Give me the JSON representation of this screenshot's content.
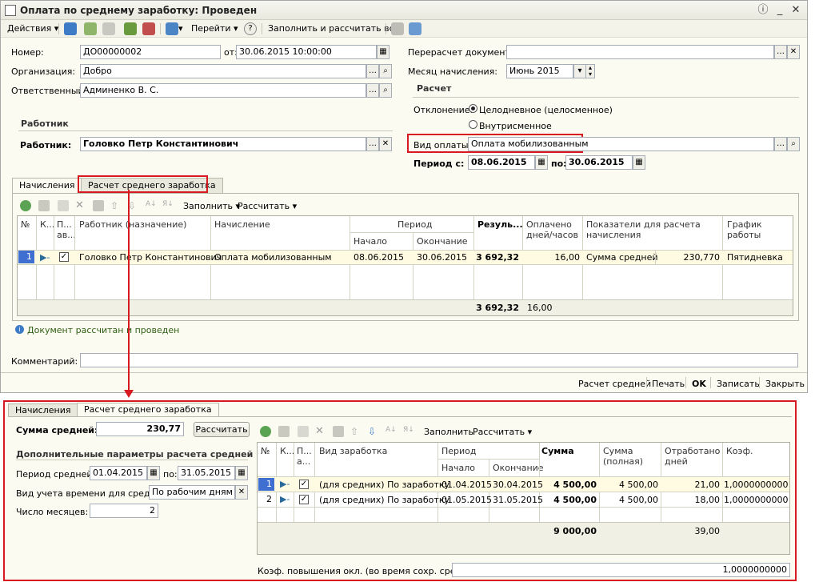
{
  "window": {
    "title": "Оплата по среднему заработку: Проведен"
  },
  "toolbar": {
    "actions": "Действия",
    "goto": "Перейти",
    "fill_calc": "Заполнить и рассчитать все",
    "help": "?"
  },
  "header": {
    "number_label": "Номер:",
    "number_value": "ДО00000002",
    "date_label": "от:",
    "date_value": "30.06.2015 10:00:00",
    "org_label": "Организация:",
    "org_value": "Добро",
    "resp_label": "Ответственный:",
    "resp_value": "Админенко В. С.",
    "recalc_label": "Перерасчет документа:",
    "recalc_value": "",
    "month_label": "Месяц начисления:",
    "month_value": "Июнь 2015"
  },
  "worker_section": {
    "title": "Работник",
    "label": "Работник:",
    "value": "Головко Петр Константинович"
  },
  "calc_section": {
    "title": "Расчет",
    "deviation_label": "Отклонение:",
    "opt1": "Целодневное (целосменное)",
    "opt2": "Внутрисменное",
    "pay_label": "Вид оплаты:",
    "pay_value": "Оплата мобилизованным",
    "period_label": "Период с:",
    "period_from": "08.06.2015",
    "period_to_label": "по:",
    "period_to": "30.06.2015"
  },
  "tabs": {
    "t1": "Начисления",
    "t2": "Расчет среднего заработка"
  },
  "grid1": {
    "fill": "Заполнить",
    "calc": "Рассчитать",
    "h_n": "№",
    "h_k": "К...",
    "h_p": "П... ав...",
    "h_worker": "Работник (назначение)",
    "h_accr": "Начисление",
    "h_period": "Период",
    "h_start": "Начало",
    "h_end": "Окончание",
    "h_result": "Резуль...",
    "h_paid": "Оплачено дней/часов",
    "h_ind": "Показатели для расчета начисления",
    "h_sched": "График работы",
    "rows": [
      {
        "n": "1",
        "worker": "Головко Петр Константинович",
        "accr": "Оплата мобилизованным",
        "start": "08.06.2015",
        "end": "30.06.2015",
        "result": "3 692,32",
        "paid": "16,00",
        "ind": "Сумма средней",
        "ind_val": "230,770",
        "sched": "Пятидневка"
      }
    ],
    "total_result": "3 692,32",
    "total_paid": "16,00"
  },
  "status": {
    "text": "Документ рассчитан и проведен"
  },
  "comment": {
    "label": "Комментарий:",
    "value": ""
  },
  "footer": {
    "b1": "Расчет средней",
    "b2": "Печать",
    "b3": "OK",
    "b4": "Записать",
    "b5": "Закрыть"
  },
  "zoom": {
    "tab1": "Начисления",
    "tab2": "Расчет среднего заработка",
    "avg_label": "Сумма средней:",
    "avg_value": "230,77",
    "calc_btn": "Рассчитать",
    "params_title": "Дополнительные параметры расчета средней",
    "period_label": "Период средней:",
    "period_from": "01.04.2015",
    "period_to_label": "по:",
    "period_to": "31.05.2015",
    "time_label": "Вид учета времени для средней:",
    "time_value": "По рабочим дням",
    "months_label": "Число месяцев:",
    "months_value": "2",
    "fill": "Заполнить",
    "calc": "Рассчитать",
    "h_n": "№",
    "h_k": "К...",
    "h_p": "П... а...",
    "h_type": "Вид заработка",
    "h_period": "Период",
    "h_start": "Начало",
    "h_end": "Окончание",
    "h_sum": "Сумма",
    "h_full": "Сумма (полная)",
    "h_worked": "Отработано дней",
    "h_coef": "Коэф.",
    "rows": [
      {
        "n": "1",
        "type": "(для средних) По заработку",
        "start": "01.04.2015",
        "end": "30.04.2015",
        "sum": "4 500,00",
        "full": "4 500,00",
        "worked": "21,00",
        "coef": "1,0000000000"
      },
      {
        "n": "2",
        "type": "(для средних) По заработку",
        "start": "01.05.2015",
        "end": "31.05.2015",
        "sum": "4 500,00",
        "full": "4 500,00",
        "worked": "18,00",
        "coef": "1,0000000000"
      }
    ],
    "total_sum": "9 000,00",
    "total_worked": "39,00",
    "kpov_label": "Коэф. повышения окл. (во время сохр. средней):",
    "kpov_value": "1,0000000000"
  }
}
